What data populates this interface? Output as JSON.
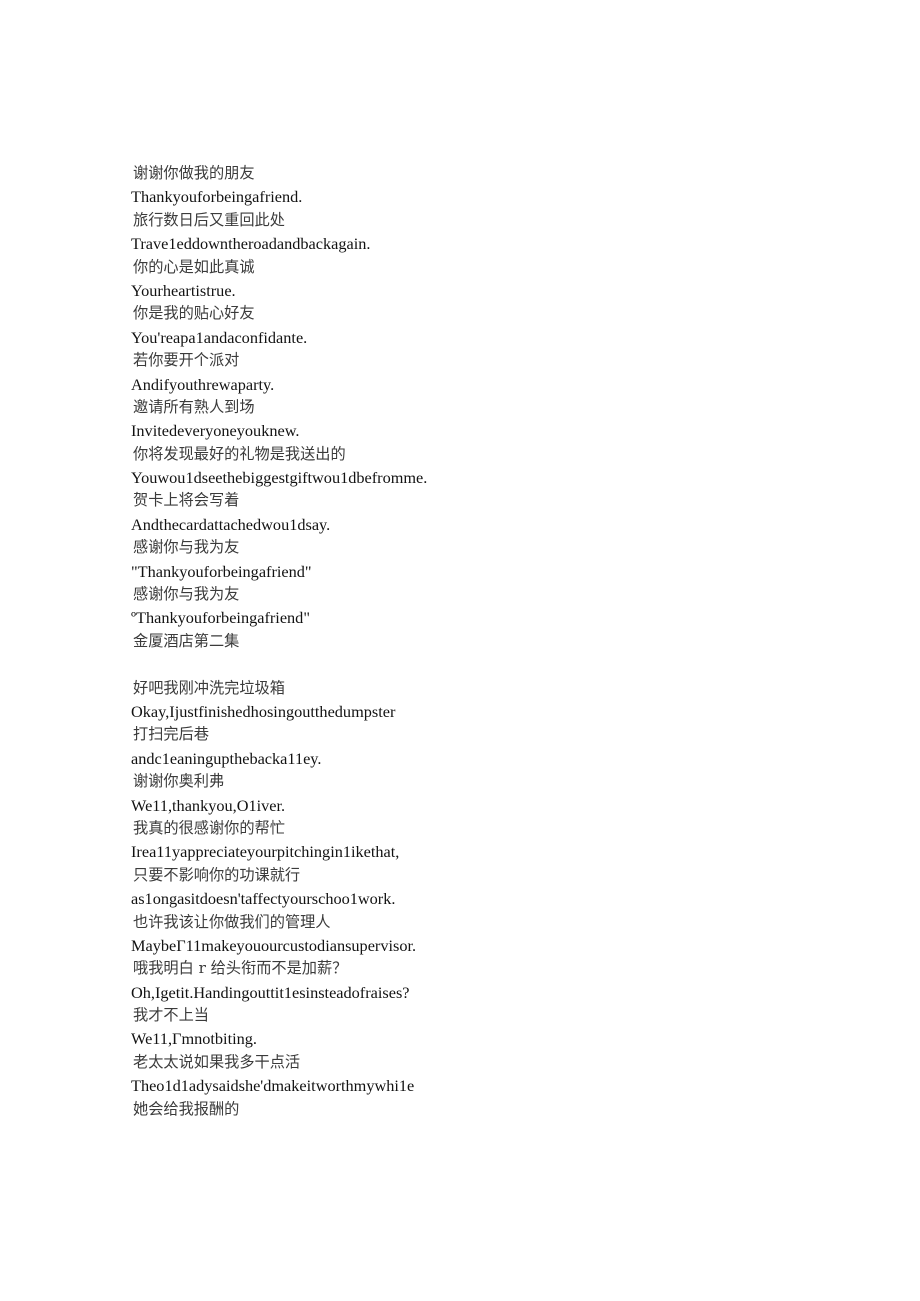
{
  "document": {
    "page_background": "#ffffff",
    "text_color_chinese": "#3b3b3b",
    "text_color_english": "#121212",
    "blocks": [
      {
        "id": "block-1",
        "lines": [
          {
            "lang": "zh",
            "text": "谢谢你做我的朋友"
          },
          {
            "lang": "en",
            "text": "Thankyouforbeingafriend."
          },
          {
            "lang": "zh",
            "text": "旅行数日后又重回此处"
          },
          {
            "lang": "en",
            "text": "Trave1eddowntheroadandbackagain."
          },
          {
            "lang": "zh",
            "text": "你的心是如此真诚"
          },
          {
            "lang": "en",
            "text": "Yourheartistrue."
          },
          {
            "lang": "zh",
            "text": "你是我的贴心好友"
          },
          {
            "lang": "en",
            "text": "You'reapa1andaconfidante."
          },
          {
            "lang": "zh",
            "text": "若你要开个派对"
          },
          {
            "lang": "en",
            "text": "Andifyouthrewaparty."
          },
          {
            "lang": "zh",
            "text": "邀请所有熟人到场"
          },
          {
            "lang": "en",
            "text": "Invitedeveryoneyouknew."
          },
          {
            "lang": "zh",
            "text": "你将发现最好的礼物是我送出的"
          },
          {
            "lang": "en",
            "text": "Youwou1dseethebiggestgiftwou1dbefromme."
          },
          {
            "lang": "zh",
            "text": "贺卡上将会写着"
          },
          {
            "lang": "en",
            "text": "Andthecardattachedwou1dsay."
          },
          {
            "lang": "zh",
            "text": "感谢你与我为友"
          },
          {
            "lang": "en",
            "text": "\"Thankyouforbeingafriend\""
          },
          {
            "lang": "zh",
            "text": "感谢你与我为友"
          },
          {
            "lang": "en",
            "text": "ºThankyouforbeingafriend\""
          },
          {
            "lang": "zh",
            "text": "金厦酒店第二集"
          }
        ]
      },
      {
        "id": "block-2",
        "lines": [
          {
            "lang": "zh",
            "text": "好吧我刚冲洗完垃圾箱"
          },
          {
            "lang": "en",
            "text": "Okay,Ijustfinishedhosingoutthedumpster"
          },
          {
            "lang": "zh",
            "text": "打扫完后巷"
          },
          {
            "lang": "en",
            "text": "andc1eaningupthebacka11ey."
          },
          {
            "lang": "zh",
            "text": "谢谢你奥利弗"
          },
          {
            "lang": "en",
            "text": "We11,thankyou,O1iver."
          },
          {
            "lang": "zh",
            "text": "我真的很感谢你的帮忙"
          },
          {
            "lang": "en",
            "text": "Irea11yappreciateyourpitchingin1ikethat,"
          },
          {
            "lang": "zh",
            "text": "只要不影响你的功课就行"
          },
          {
            "lang": "en",
            "text": "as1ongasitdoesn'taffectyourschoo1work."
          },
          {
            "lang": "zh",
            "text": "也许我该让你做我们的管理人"
          },
          {
            "lang": "en",
            "text": "MaybeΓ11makeyouourcustodiansupervisor."
          },
          {
            "lang": "zh",
            "text": "哦我明白 r 给头衔而不是加薪？"
          },
          {
            "lang": "en",
            "text": "Oh,Igetit.Handingouttit1esinsteadofraises?"
          },
          {
            "lang": "zh",
            "text": "我才不上当"
          },
          {
            "lang": "en",
            "text": "We11,Γmnotbiting."
          },
          {
            "lang": "zh",
            "text": "老太太说如果我多干点活"
          },
          {
            "lang": "en",
            "text": "Theo1d1adysaidshe'dmakeitworthmywhi1e"
          },
          {
            "lang": "zh",
            "text": "她会给我报酬的"
          }
        ]
      }
    ]
  }
}
